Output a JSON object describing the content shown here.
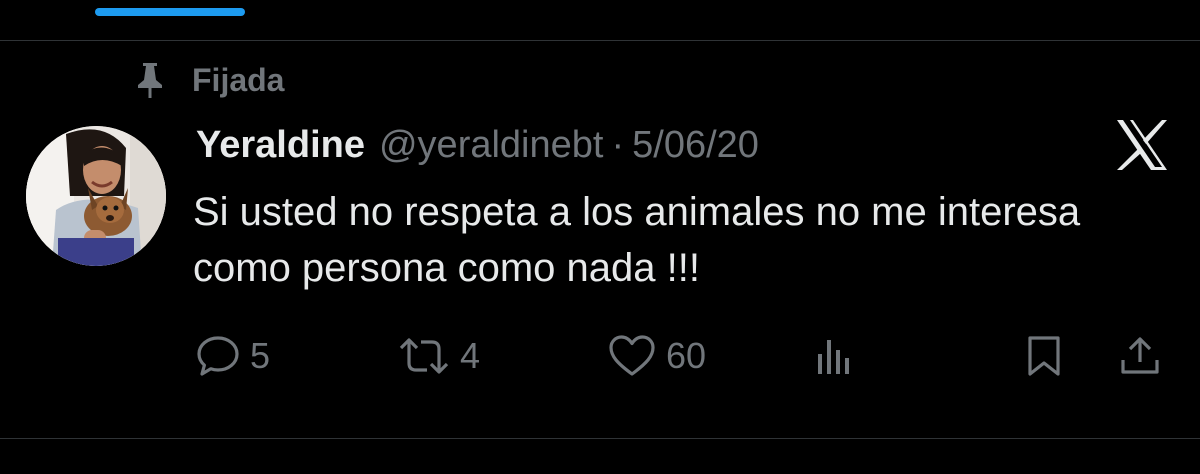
{
  "pinned": {
    "label": "Fijada",
    "icon": "pin-icon"
  },
  "author": {
    "name": "Yeraldine",
    "handle": "@yeraldinebt",
    "separator": "·",
    "date": "5/06/20"
  },
  "tweet": {
    "text": "Si usted no respeta a los animales no me interesa como persona como nada !!!"
  },
  "actions": {
    "replies": "5",
    "retweets": "4",
    "likes": "60"
  },
  "colors": {
    "background": "#000000",
    "primary_text": "#e7e9ea",
    "secondary_text": "#71767b",
    "accent": "#1d9bf0",
    "divider": "#2f3336"
  }
}
